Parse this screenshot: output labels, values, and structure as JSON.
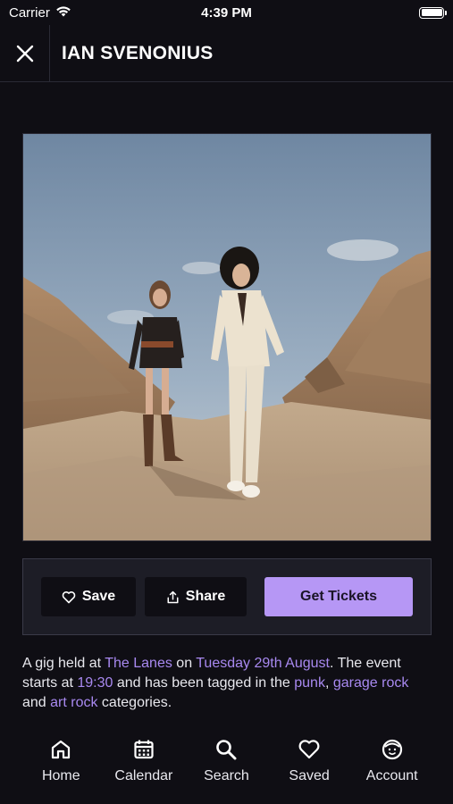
{
  "status_bar": {
    "carrier": "Carrier",
    "time": "4:39 PM",
    "battery_level": 1.0
  },
  "header": {
    "title": "IAN SVENONIUS",
    "close_icon": "close-icon"
  },
  "hero": {
    "image": "artist-photo"
  },
  "actions": {
    "save_label": "Save",
    "share_label": "Share",
    "tickets_label": "Get Tickets"
  },
  "description": {
    "part1": "A gig held at ",
    "venue": "The Lanes",
    "part2": " on ",
    "date": "Tuesday 29th August",
    "part3": ". The event starts at ",
    "time": "19:30",
    "part4": " and has been tagged in the ",
    "tag1": "punk",
    "sep1": ", ",
    "tag2": "garage rock",
    "part5": " and ",
    "tag3": "art rock",
    "part6": " categories."
  },
  "tabs": [
    {
      "label": "Home",
      "icon": "home-icon"
    },
    {
      "label": "Calendar",
      "icon": "calendar-icon"
    },
    {
      "label": "Search",
      "icon": "search-icon"
    },
    {
      "label": "Saved",
      "icon": "heart-icon"
    },
    {
      "label": "Account",
      "icon": "account-icon"
    }
  ],
  "colors": {
    "background": "#0f0e14",
    "accent": "#b697f5",
    "link": "#a889f0",
    "panel": "#1d1d26"
  }
}
